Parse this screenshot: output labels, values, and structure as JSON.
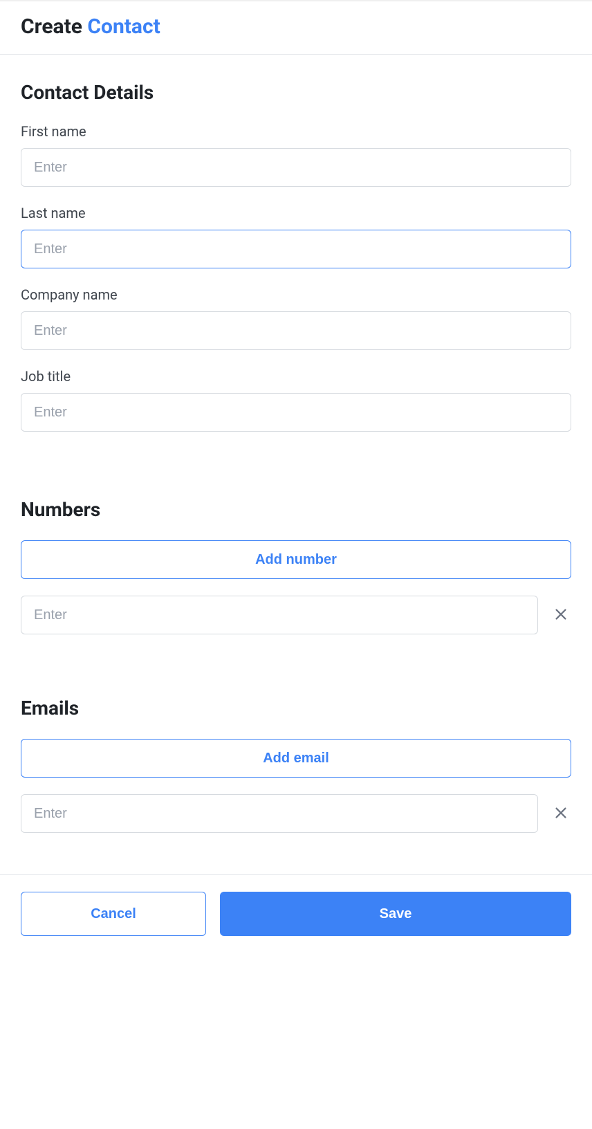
{
  "header": {
    "title_prefix": "Create ",
    "title_accent": "Contact"
  },
  "sections": {
    "contactDetails": {
      "heading": "Contact Details",
      "fields": {
        "firstName": {
          "label": "First name",
          "placeholder": "Enter",
          "value": ""
        },
        "lastName": {
          "label": "Last name",
          "placeholder": "Enter",
          "value": "",
          "focused": true
        },
        "company": {
          "label": "Company name",
          "placeholder": "Enter",
          "value": ""
        },
        "jobTitle": {
          "label": "Job title",
          "placeholder": "Enter",
          "value": ""
        }
      }
    },
    "numbers": {
      "heading": "Numbers",
      "addLabel": "Add number",
      "entryPlaceholder": "Enter",
      "entryValue": ""
    },
    "emails": {
      "heading": "Emails",
      "addLabel": "Add email",
      "entryPlaceholder": "Enter",
      "entryValue": ""
    }
  },
  "footer": {
    "cancel": "Cancel",
    "save": "Save"
  }
}
